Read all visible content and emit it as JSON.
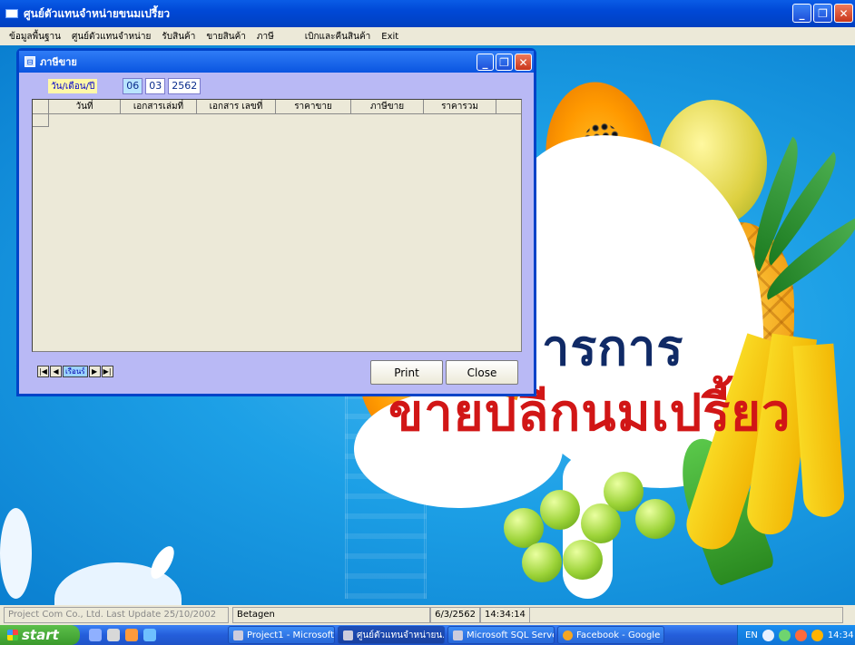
{
  "app": {
    "title": "ศูนย์ตัวแทนจำหน่ายขนมเปรี้ยว",
    "min": "_",
    "max": "❐",
    "close": "✕"
  },
  "menu": [
    "ข้อมูลพื้นฐาน",
    "ศูนย์ตัวแทนจำหน่าย",
    "รับสินค้า",
    "ขายสินค้า",
    "ภาษี",
    "เบิกและคืนสินค้า",
    "Exit"
  ],
  "background": {
    "line1": "ารการ",
    "line2": "ขายปลีกนมเปรี้ยว"
  },
  "dialog": {
    "title": "ภาษีขาย",
    "icon": "⊟",
    "date_label": "วัน/เดือน/ปี",
    "day": "06",
    "month": "03",
    "year": "2562",
    "columns": [
      "วันที่",
      "เอกสารเล่มที่",
      "เอกสาร เลขที่",
      "ราคาขาย",
      "ภาษีขาย",
      "ราคารวม"
    ],
    "nav_first": "|◀",
    "nav_prev": "◀",
    "nav_record": "เรือนร์",
    "nav_next": "▶",
    "nav_last": "▶|",
    "print_label": "Print",
    "close_label": "Close"
  },
  "status": {
    "copyright": "Project Com Co., Ltd. Last Update 25/10/2002",
    "user": "Betagen",
    "date": "6/3/2562",
    "time": "14:34:14"
  },
  "taskbar": {
    "start": "start",
    "tasks": [
      "Project1 - Microsoft ...",
      "ศูนย์ตัวแทนจำหน่ายน...",
      "Microsoft SQL Serve...",
      "Facebook - Google C..."
    ],
    "lang": "EN",
    "clock": "14:34"
  }
}
